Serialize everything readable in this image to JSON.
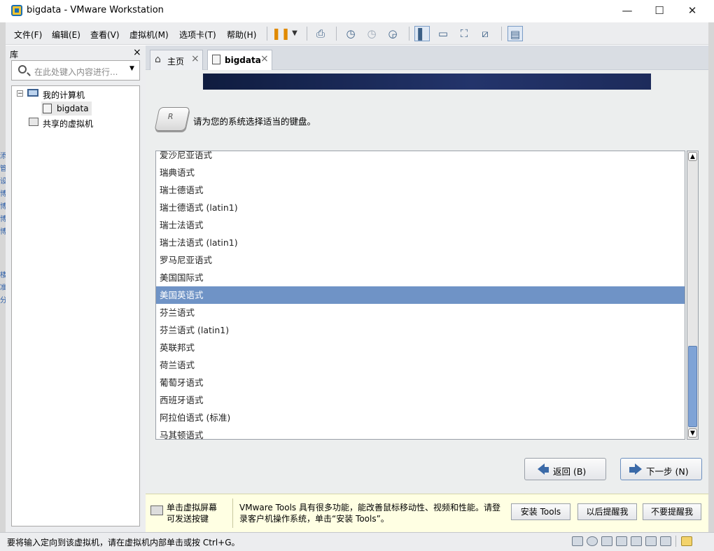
{
  "window": {
    "title": "bigdata - VMware Workstation",
    "minimize": "—",
    "maximize": "☐",
    "close": "✕"
  },
  "menu": [
    "文件(F)",
    "编辑(E)",
    "查看(V)",
    "虚拟机(M)",
    "选项卡(T)",
    "帮助(H)"
  ],
  "library": {
    "title": "库",
    "close": "×",
    "search_placeholder": "在此处键入内容进行...",
    "tree": {
      "my_computer": "我的计算机",
      "vm": "bigdata",
      "shared": "共享的虚拟机"
    }
  },
  "tabs": [
    {
      "label": "主页",
      "close": "×"
    },
    {
      "label": "bigdata",
      "close": "×"
    }
  ],
  "installer": {
    "prompt": "请为您的系统选择适当的键盘。",
    "items": [
      "爱沙尼亚语式",
      "瑞典语式",
      "瑞士德语式",
      "瑞士德语式 (latin1)",
      "瑞士法语式",
      "瑞士法语式 (latin1)",
      "罗马尼亚语式",
      "美国国际式",
      "美国英语式",
      "芬兰语式",
      "芬兰语式 (latin1)",
      "英联邦式",
      "荷兰语式",
      "葡萄牙语式",
      "西班牙语式",
      "阿拉伯语式 (标准)",
      "马其顿语式"
    ],
    "selected_index": 8,
    "back_label": "返回 (B)",
    "next_label": "下一步 (N)"
  },
  "notification": {
    "hint_line1": "单击虚拟屏幕",
    "hint_line2": "可发送按键",
    "message_line1": "VMware Tools 具有很多功能，能改善鼠标移动性、视频和性能。请登",
    "message_line2": "录客户机操作系统，单击“安装 Tools”。",
    "install": "安装 Tools",
    "remind": "以后提醒我",
    "never": "不要提醒我"
  },
  "status": {
    "text": "要将输入定向到该虚拟机，请在虚拟机内部单击或按 Ctrl+G。"
  },
  "colors": {
    "selection": "#6f93c6",
    "banner": "#1a2a5a",
    "notification_bg": "#ffffe3",
    "accent": "#3b5f86"
  }
}
